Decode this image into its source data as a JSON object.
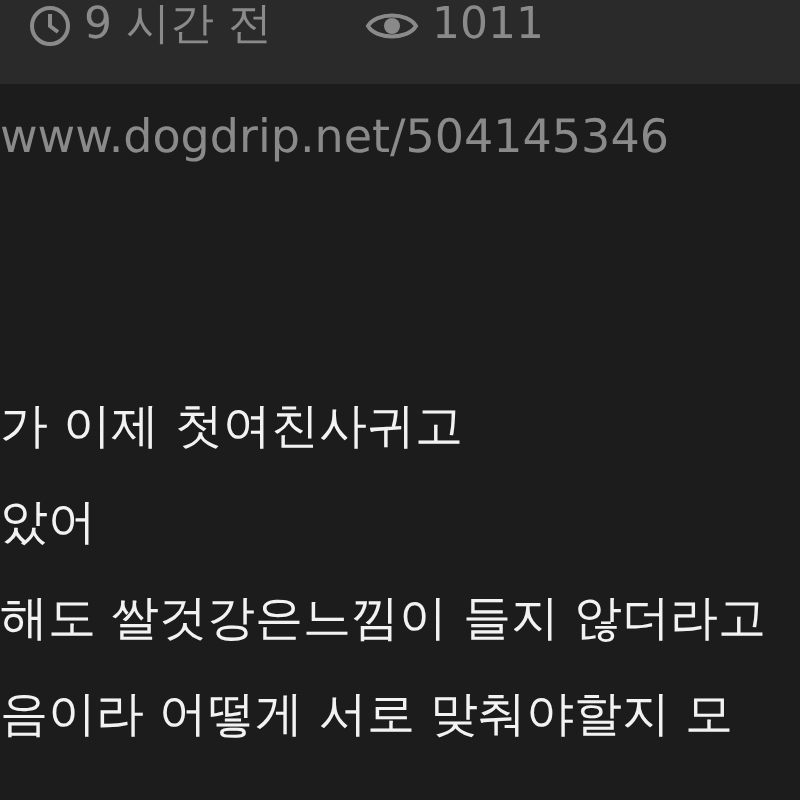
{
  "post_meta": {
    "time": "9 시간 전",
    "views": "1011"
  },
  "source_url": "www.dogdrip.net/504145346",
  "body_lines": [
    "가 이제 첫여친사귀고",
    "았어",
    "해도 쌀것강은느낌이  들지 않더라고",
    "음이라 어떻게 서로 맞춰야할지 모"
  ]
}
